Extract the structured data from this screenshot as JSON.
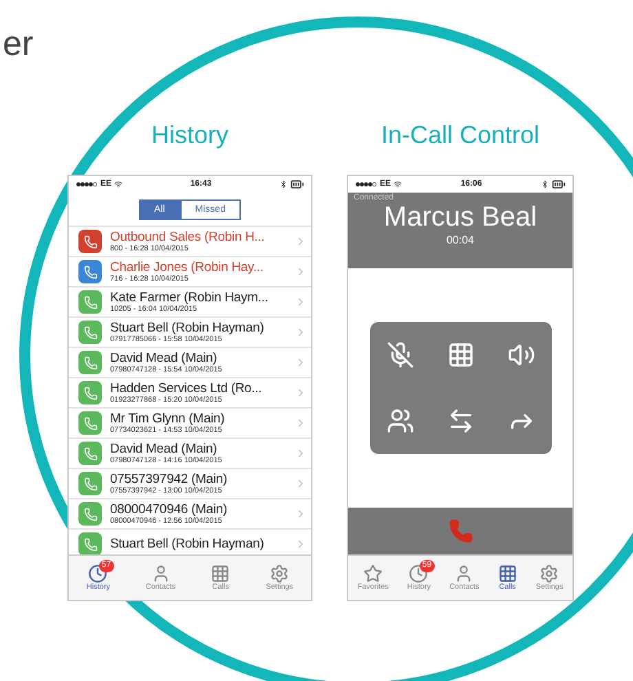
{
  "heading": "er",
  "history": {
    "label": "History",
    "status_bar": {
      "carrier": "EE",
      "time": "16:43"
    },
    "segments": [
      {
        "label": "All",
        "selected": true
      },
      {
        "label": "Missed",
        "selected": false
      }
    ],
    "calls": [
      {
        "name": "Outbound Sales (Robin H...",
        "detail": "800 - 16:28 10/04/2015",
        "missed": true,
        "color": "#d2402e"
      },
      {
        "name": "Charlie Jones (Robin Hay...",
        "detail": "716 - 16:28 10/04/2015",
        "missed": true,
        "color": "#3c86d6"
      },
      {
        "name": "Kate Farmer (Robin Haym...",
        "detail": "10205 - 16:04 10/04/2015",
        "missed": false,
        "color": "#5cb85c"
      },
      {
        "name": "Stuart Bell (Robin Hayman)",
        "detail": "07917785066 - 15:58 10/04/2015",
        "missed": false,
        "color": "#5cb85c"
      },
      {
        "name": "David Mead (Main)",
        "detail": "07980747128 - 15:54 10/04/2015",
        "missed": false,
        "color": "#5cb85c"
      },
      {
        "name": "Hadden Services Ltd (Ro...",
        "detail": "01923277868 - 15:20 10/04/2015",
        "missed": false,
        "color": "#5cb85c"
      },
      {
        "name": "Mr Tim Glynn (Main)",
        "detail": "07734023621 - 14:53 10/04/2015",
        "missed": false,
        "color": "#5cb85c"
      },
      {
        "name": "David Mead (Main)",
        "detail": "07980747128 - 14:16 10/04/2015",
        "missed": false,
        "color": "#5cb85c"
      },
      {
        "name": "07557397942 (Main)",
        "detail": "07557397942 - 13:00 10/04/2015",
        "missed": false,
        "color": "#5cb85c"
      },
      {
        "name": "08000470946 (Main)",
        "detail": "08000470946 - 12:56 10/04/2015",
        "missed": false,
        "color": "#5cb85c"
      },
      {
        "name": "Stuart Bell (Robin Hayman)",
        "missed": false,
        "color": "#5cb85c"
      }
    ],
    "tabs": [
      {
        "kind": "history",
        "label": "History",
        "badge": "57",
        "selected": true
      },
      {
        "kind": "contacts",
        "label": "Contacts",
        "selected": false
      },
      {
        "kind": "calls",
        "label": "Calls",
        "selected": false
      },
      {
        "kind": "settings",
        "label": "Settings",
        "selected": false
      }
    ]
  },
  "in_call": {
    "label": "In-Call Control",
    "status_bar": {
      "carrier": "EE",
      "time": "16:06"
    },
    "state": "Connected",
    "caller": "Marcus Beal",
    "duration": "00:04",
    "controls": [
      {
        "kind": "mute"
      },
      {
        "kind": "keypad"
      },
      {
        "kind": "speaker"
      },
      {
        "kind": "conference"
      },
      {
        "kind": "transfer"
      },
      {
        "kind": "forward"
      }
    ],
    "tabs": [
      {
        "kind": "favorites",
        "label": "Favorites",
        "selected": false
      },
      {
        "kind": "history",
        "label": "History",
        "badge": "59",
        "selected": false
      },
      {
        "kind": "contacts",
        "label": "Contacts",
        "selected": false
      },
      {
        "kind": "calls",
        "label": "Calls",
        "selected": true
      },
      {
        "kind": "settings",
        "label": "Settings",
        "selected": false
      }
    ]
  }
}
